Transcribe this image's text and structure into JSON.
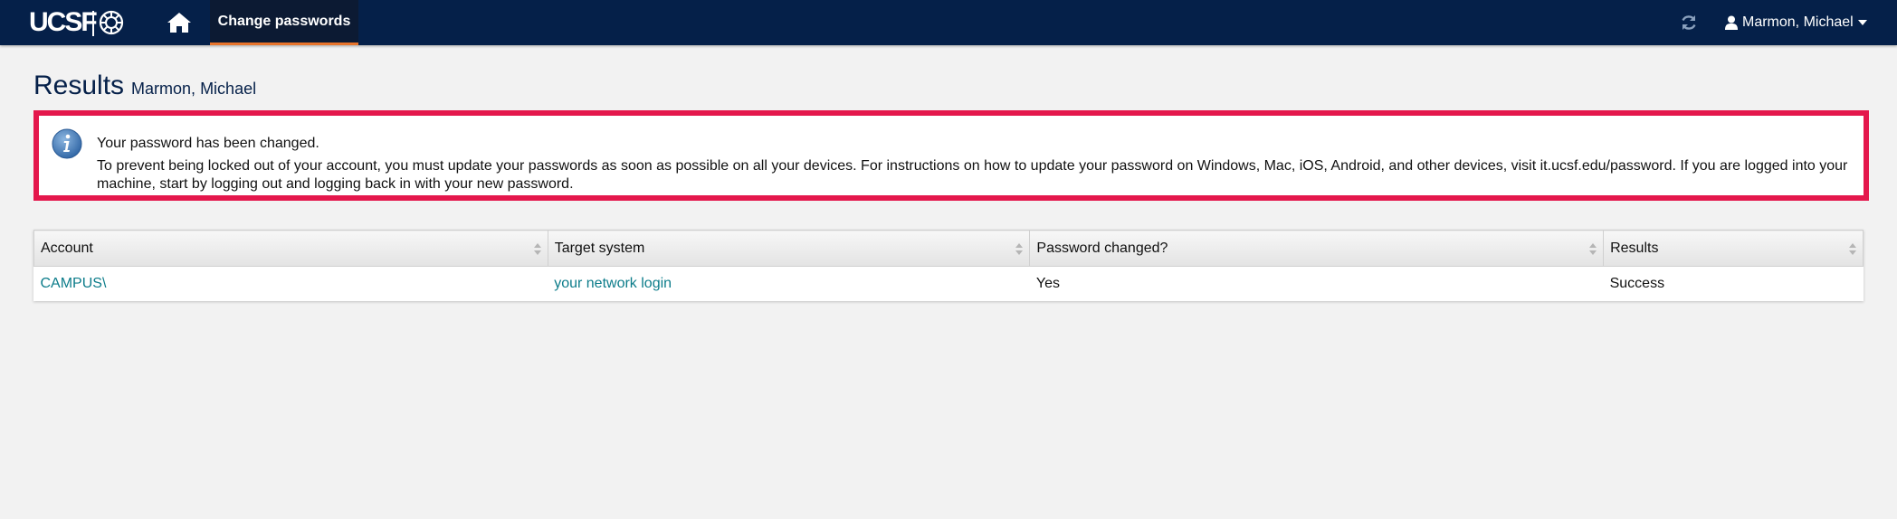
{
  "navbar": {
    "logo_text": "UCSF",
    "active_tab": "Change passwords",
    "user_name": "Marmon, Michael",
    "background_color": "#052049",
    "active_tab_underline_color": "#e8742b",
    "icons": [
      "ucsf-seal-icon",
      "home-icon",
      "refresh-icon",
      "user-icon",
      "caret-down-icon"
    ]
  },
  "page": {
    "title": "Results",
    "subtitle": "Marmon, Michael"
  },
  "alert": {
    "border_color": "#e4174c",
    "icon": "info-icon",
    "line1": "Your password has been changed.",
    "line2": "To prevent being locked out of your account, you must update your passwords as soon as possible on all your devices. For instructions on how to update your password on Windows, Mac, iOS, Android, and other devices, visit it.ucsf.edu/password. If you are logged into your machine, start by logging out and logging back in with your new password."
  },
  "table": {
    "columns": [
      "Account",
      "Target system",
      "Password changed?",
      "Results"
    ],
    "rows": [
      {
        "account": "CAMPUS\\",
        "target_system": "your network login",
        "password_changed": "Yes",
        "result": "Success"
      }
    ],
    "link_color": "#0c7c8a"
  }
}
